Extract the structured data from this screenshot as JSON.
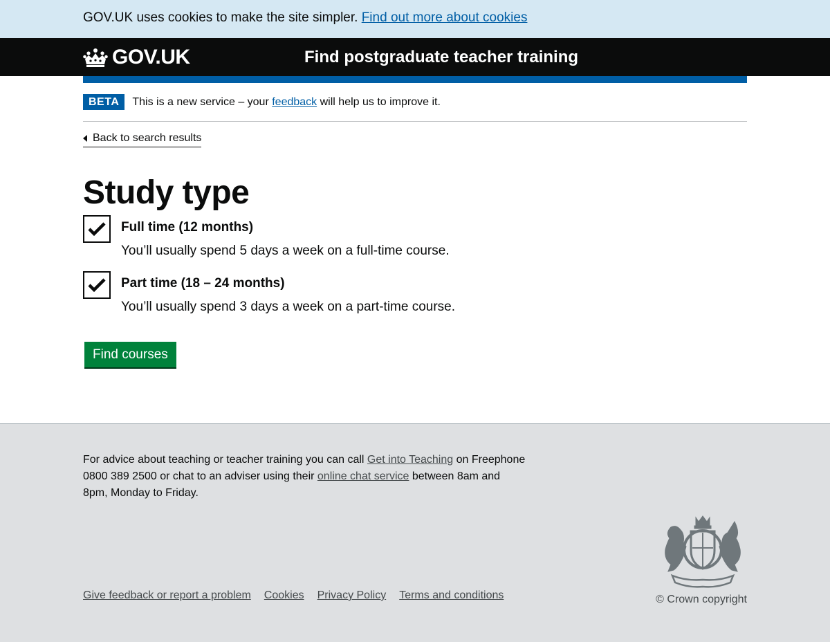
{
  "cookie_banner": {
    "text": "GOV.UK uses cookies to make the site simpler.",
    "link": "Find out more about cookies"
  },
  "header": {
    "logo_text": "GOV.UK",
    "service_name": "Find postgraduate teacher training"
  },
  "phase_banner": {
    "tag": "BETA",
    "text_before": "This is a new service – your",
    "link": "feedback",
    "text_after": "will help us to improve it."
  },
  "back_link": "Back to search results",
  "page": {
    "title": "Study type",
    "options": [
      {
        "label": "Full time (12 months)",
        "hint": "You’ll usually spend 5 days a week on a full-time course.",
        "checked": true
      },
      {
        "label": "Part time (18 – 24 months)",
        "hint": "You’ll usually spend 3 days a week on a part-time course.",
        "checked": true
      }
    ],
    "submit": "Find courses"
  },
  "footer": {
    "advice_1": "For advice about teaching or teacher training you can call",
    "advice_link_1": "Get into Teaching",
    "advice_2": "on Freephone 0800 389 2500 or chat to an adviser using their",
    "advice_link_2": "online chat service",
    "advice_3": "between 8am and 8pm, Monday to Friday.",
    "links": [
      "Give feedback or report a problem",
      "Cookies",
      "Privacy Policy",
      "Terms and conditions"
    ],
    "copyright": "© Crown copyright"
  },
  "colors": {
    "brand_blue": "#005ea5",
    "button_green": "#00823b",
    "header_black": "#0b0c0c",
    "footer_grey": "#dee0e2",
    "cookie_blue": "#d5e8f3"
  },
  "icons": [
    "crown-icon",
    "checkmark-icon",
    "back-arrow-icon",
    "royal-crest-icon"
  ]
}
